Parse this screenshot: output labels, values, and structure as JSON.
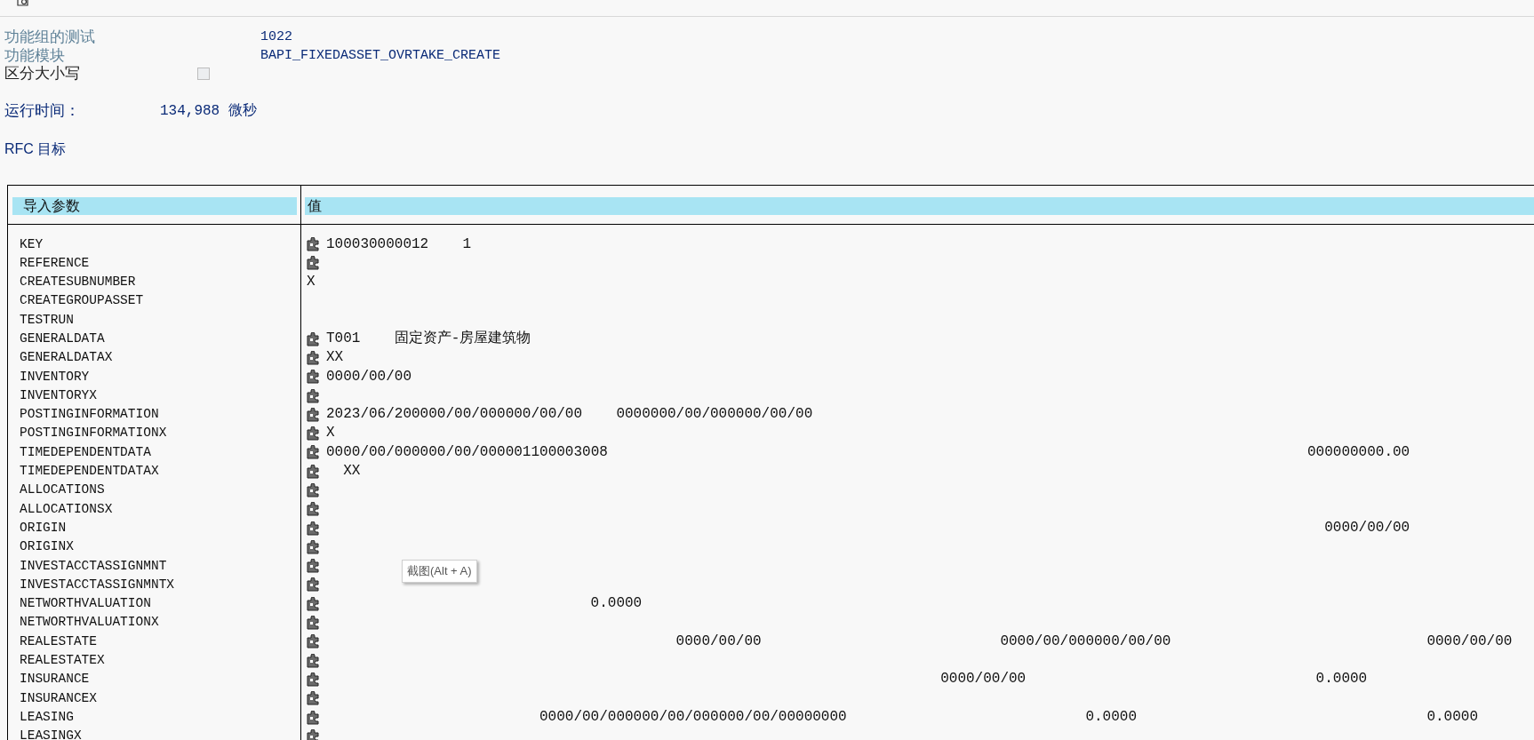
{
  "header_fields": [
    {
      "kind": "text",
      "label": "功能组的测试",
      "value": "1022"
    },
    {
      "kind": "text",
      "label": "功能模块",
      "value": "BAPI_FIXEDASSET_OVRTAKE_CREATE"
    },
    {
      "kind": "checkbox",
      "label": "区分大小写",
      "checked": false
    }
  ],
  "runtime": {
    "label": "运行时间：",
    "value": "134,988 微秒"
  },
  "rfc_target": {
    "label": "RFC 目标"
  },
  "table": {
    "columns": [
      "导入参数",
      "值"
    ],
    "rows": [
      {
        "name": "KEY",
        "icon": true,
        "value": [
          "100030000012",
          "1"
        ]
      },
      {
        "name": "REFERENCE",
        "icon": true,
        "value": []
      },
      {
        "name": "CREATESUBNUMBER",
        "icon": false,
        "value": [
          "X"
        ]
      },
      {
        "name": "CREATEGROUPASSET",
        "icon": false,
        "value": []
      },
      {
        "name": "TESTRUN",
        "icon": false,
        "value": []
      },
      {
        "name": "GENERALDATA",
        "icon": true,
        "value": [
          "T001",
          "固定资产-房屋建筑物"
        ]
      },
      {
        "name": "GENERALDATAX",
        "icon": true,
        "value": [
          "XX"
        ]
      },
      {
        "name": "INVENTORY",
        "icon": true,
        "value": [
          "0000/00/00"
        ]
      },
      {
        "name": "INVENTORYX",
        "icon": true,
        "value": []
      },
      {
        "name": "POSTINGINFORMATION",
        "icon": true,
        "value": [
          "2023/06/200000/00/000000/00/00",
          "0000000/00/000000/00/00"
        ]
      },
      {
        "name": "POSTINGINFORMATIONX",
        "icon": true,
        "value": [
          "X"
        ]
      },
      {
        "name": "TIMEDEPENDENTDATA",
        "icon": true,
        "value": [
          "0000/00/000000/00/000001100003008",
          "000000000.00"
        ]
      },
      {
        "name": "TIMEDEPENDENTDATAX",
        "icon": true,
        "value": [
          "XX"
        ]
      },
      {
        "name": "ALLOCATIONS",
        "icon": true,
        "value": []
      },
      {
        "name": "ALLOCATIONSX",
        "icon": true,
        "value": []
      },
      {
        "name": "ORIGIN",
        "icon": true,
        "value": [
          "0000/00/00"
        ]
      },
      {
        "name": "ORIGINX",
        "icon": true,
        "value": []
      },
      {
        "name": "INVESTACCTASSIGNMNT",
        "icon": true,
        "value": []
      },
      {
        "name": "INVESTACCTASSIGNMNTX",
        "icon": true,
        "value": []
      },
      {
        "name": "NETWORTHVALUATION",
        "icon": true,
        "value": [
          "0.0000"
        ]
      },
      {
        "name": "NETWORTHVALUATIONX",
        "icon": true,
        "value": []
      },
      {
        "name": "REALESTATE",
        "icon": true,
        "value": [
          "0000/00/00",
          "0000/00/000000/00/00",
          "0000/00/00"
        ]
      },
      {
        "name": "REALESTATEX",
        "icon": true,
        "value": []
      },
      {
        "name": "INSURANCE",
        "icon": true,
        "value": [
          "0000/00/00",
          "0.0000"
        ]
      },
      {
        "name": "INSURANCEX",
        "icon": true,
        "value": []
      },
      {
        "name": "LEASING",
        "icon": true,
        "value": [
          "0000/00/000000/00/000000/00/00000000",
          "0.0000",
          "0.0000"
        ]
      },
      {
        "name": "LEASINGX",
        "icon": true,
        "value": []
      }
    ]
  },
  "tooltip": {
    "text": "截图(Alt + A)"
  }
}
